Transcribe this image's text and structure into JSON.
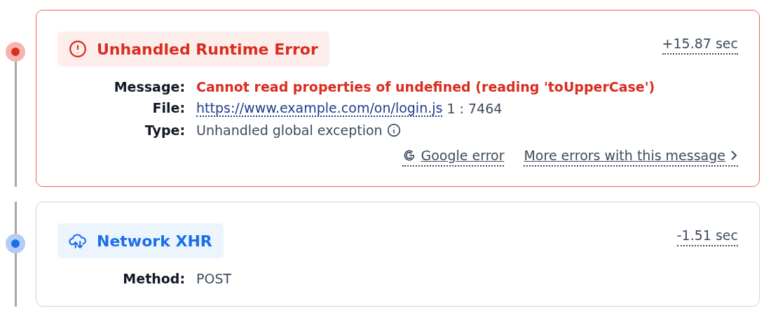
{
  "events": [
    {
      "kind": "error",
      "title": "Unhandled Runtime Error",
      "time": "+15.87 sec",
      "fields": [
        {
          "kind": "message",
          "label": "Message:",
          "value": "Cannot read properties of undefined (reading 'toUpperCase')"
        },
        {
          "kind": "link",
          "label": "File:",
          "value": "https://www.example.com/on/login.js",
          "suffix": "1 : 7464"
        },
        {
          "kind": "info",
          "label": "Type:",
          "value": "Unhandled global exception"
        }
      ],
      "actions": [
        {
          "kind": "google",
          "label": "Google error"
        },
        {
          "kind": "more",
          "label": "More errors with this message"
        }
      ]
    },
    {
      "kind": "network",
      "title": "Network XHR",
      "time": "-1.51 sec",
      "fields": [
        {
          "kind": "text",
          "label": "Method:",
          "value": "POST"
        }
      ]
    }
  ]
}
